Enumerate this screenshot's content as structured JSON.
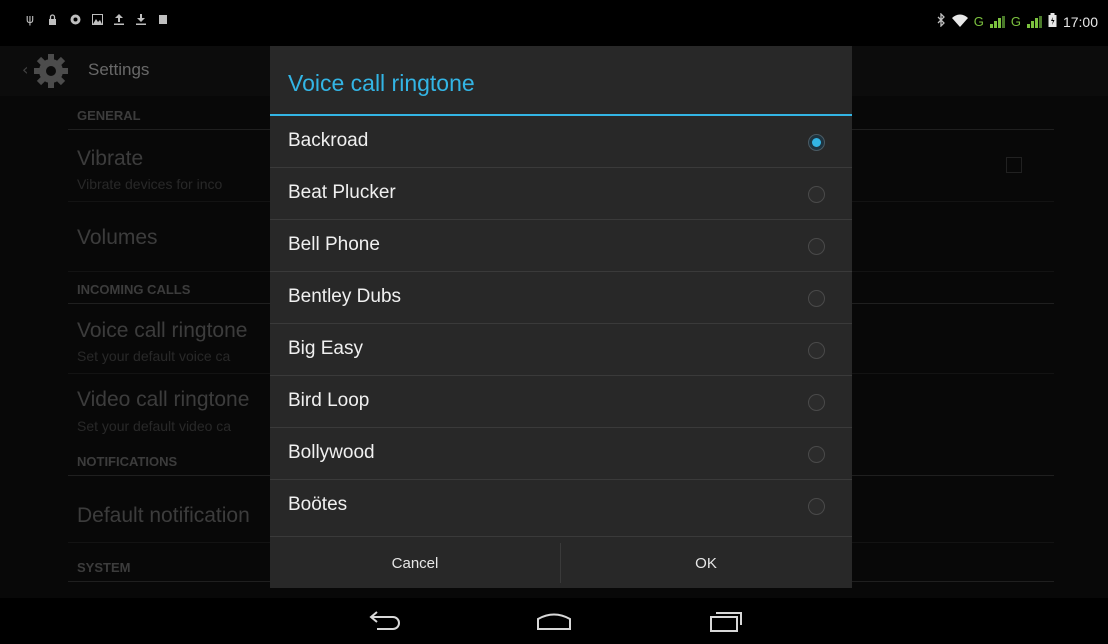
{
  "status_bar": {
    "left_icons": [
      "usb-icon",
      "lock-icon",
      "sync-icon",
      "image-icon",
      "upload-icon",
      "download-icon",
      "stop-icon"
    ],
    "signal_label_1": "G",
    "signal_label_2": "G",
    "time": "17:00"
  },
  "app": {
    "title": "Settings",
    "sections": {
      "general": "GENERAL",
      "incoming_calls": "INCOMING CALLS",
      "notifications": "NOTIFICATIONS",
      "system": "SYSTEM"
    },
    "items": {
      "vibrate_title": "Vibrate",
      "vibrate_sub": "Vibrate devices for inco",
      "volumes_title": "Volumes",
      "voice_title": "Voice call ringtone",
      "voice_sub": "Set your default voice ca",
      "video_title": "Video call ringtone",
      "video_sub": "Set your default video ca",
      "default_notification_title": "Default notification"
    }
  },
  "dialog": {
    "title": "Voice call ringtone",
    "options": [
      {
        "label": "Backroad",
        "checked": true
      },
      {
        "label": "Beat Plucker",
        "checked": false
      },
      {
        "label": "Bell Phone",
        "checked": false
      },
      {
        "label": "Bentley Dubs",
        "checked": false
      },
      {
        "label": "Big Easy",
        "checked": false
      },
      {
        "label": "Bird Loop",
        "checked": false
      },
      {
        "label": "Bollywood",
        "checked": false
      },
      {
        "label": "Boötes",
        "checked": false
      }
    ],
    "cancel_label": "Cancel",
    "ok_label": "OK"
  },
  "colors": {
    "accent": "#33b5e5",
    "dialog_bg": "#282828",
    "signal_green": "#7cc23f"
  }
}
